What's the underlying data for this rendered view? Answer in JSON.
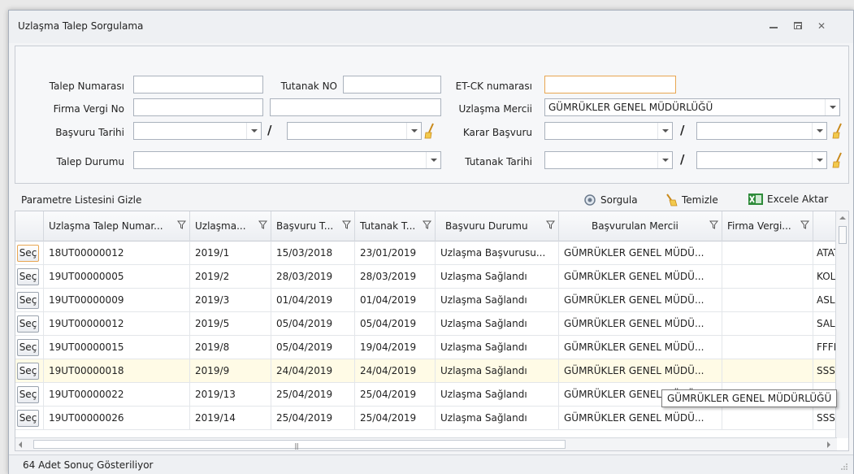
{
  "window": {
    "title": "Uzlaşma Talep Sorgulama"
  },
  "params": {
    "talep_numarasi_label": "Talep  Numarası",
    "talep_numarasi_value": "",
    "tutanak_no_label": "Tutanak NO",
    "tutanak_no_value": "",
    "etck_label": "ET-CK numarası",
    "etck_value": "",
    "firma_vergi_label": "Firma Vergi No",
    "firma_vergi_value": "",
    "firma_vergi_value2": "",
    "uzlasma_mercii_label": "Uzlaşma Mercii",
    "uzlasma_mercii_value": "GÜMRÜKLER GENEL MÜDÜRLÜĞÜ",
    "basvuru_tarihi_label": "Başvuru Tarihi",
    "karar_basvuru_label": "Karar Başvuru",
    "talep_durumu_label": "Talep  Durumu",
    "tutanak_tarihi_label": "Tutanak Tarihi",
    "date_separator": "/"
  },
  "toolbar": {
    "toggle_label": "Parametre Listesini Gizle",
    "sorgula_label": "Sorgula",
    "temizle_label": "Temizle",
    "excel_label": "Excele Aktar"
  },
  "grid": {
    "columns": [
      "Uzlaşma Talep Numar...",
      "Uzlaşma...",
      "Başvuru T...",
      "Tutanak T...",
      "Başvuru Durumu",
      "Başvurulan Mercii",
      "Firma Vergi..."
    ],
    "select_label": "Seç",
    "rows": [
      {
        "no": "18UT00000012",
        "uz": "2019/1",
        "bt": "15/03/2018",
        "tt": "23/01/2019",
        "durum": "Uzlaşma Başvurusu...",
        "mercii": "GÜMRÜKLER GENEL MÜDÜ...",
        "vergi": "",
        "extra": "ATATÜ"
      },
      {
        "no": "19UT00000005",
        "uz": "2019/2",
        "bt": "28/03/2019",
        "tt": "28/03/2019",
        "durum": "Uzlaşma Sağlandı",
        "mercii": "GÜMRÜKLER GENEL MÜDÜ...",
        "vergi": "",
        "extra": "KOL"
      },
      {
        "no": "19UT00000009",
        "uz": "2019/3",
        "bt": "01/04/2019",
        "tt": "01/04/2019",
        "durum": "Uzlaşma Sağlandı",
        "mercii": "GÜMRÜKLER GENEL MÜDÜ...",
        "vergi": "",
        "extra": "ASLAI"
      },
      {
        "no": "19UT00000012",
        "uz": "2019/5",
        "bt": "05/04/2019",
        "tt": "05/04/2019",
        "durum": "Uzlaşma Sağlandı",
        "mercii": "GÜMRÜKLER GENEL MÜDÜ...",
        "vergi": "",
        "extra": "SALKA"
      },
      {
        "no": "19UT00000015",
        "uz": "2019/8",
        "bt": "05/04/2019",
        "tt": "19/04/2019",
        "durum": "Uzlaşma Sağlandı",
        "mercii": "GÜMRÜKLER GENEL MÜDÜ...",
        "vergi": "",
        "extra": "FFFF"
      },
      {
        "no": "19UT00000018",
        "uz": "2019/9",
        "bt": "24/04/2019",
        "tt": "24/04/2019",
        "durum": "Uzlaşma Sağlandı",
        "mercii": "GÜMRÜKLER GENEL MÜDÜ...",
        "vergi": "",
        "extra": "SSSS"
      },
      {
        "no": "19UT00000022",
        "uz": "2019/13",
        "bt": "25/04/2019",
        "tt": "25/04/2019",
        "durum": "Uzlaşma Sağlandı",
        "mercii": "GÜMRÜKLER GENEL MÜDÜ...",
        "vergi": "",
        "extra": ""
      },
      {
        "no": "19UT00000026",
        "uz": "2019/14",
        "bt": "25/04/2019",
        "tt": "25/04/2019",
        "durum": "Uzlaşma Sağlandı",
        "mercii": "GÜMRÜKLER GENEL MÜDÜ...",
        "vergi": "",
        "extra": "SSS"
      }
    ]
  },
  "tooltip": {
    "text": "GÜMRÜKLER GENEL MÜDÜRLÜĞÜ"
  },
  "status": {
    "text": "64 Adet Sonuç Gösteriliyor"
  },
  "colors": {
    "focus_border": "#e8a652",
    "highlight_row": "#fffbe6",
    "excel_green": "#2e8b3a"
  },
  "icons": {
    "sorgula": "gear-search-icon",
    "temizle": "broom-icon",
    "excel": "excel-icon",
    "filter": "filter-icon"
  }
}
